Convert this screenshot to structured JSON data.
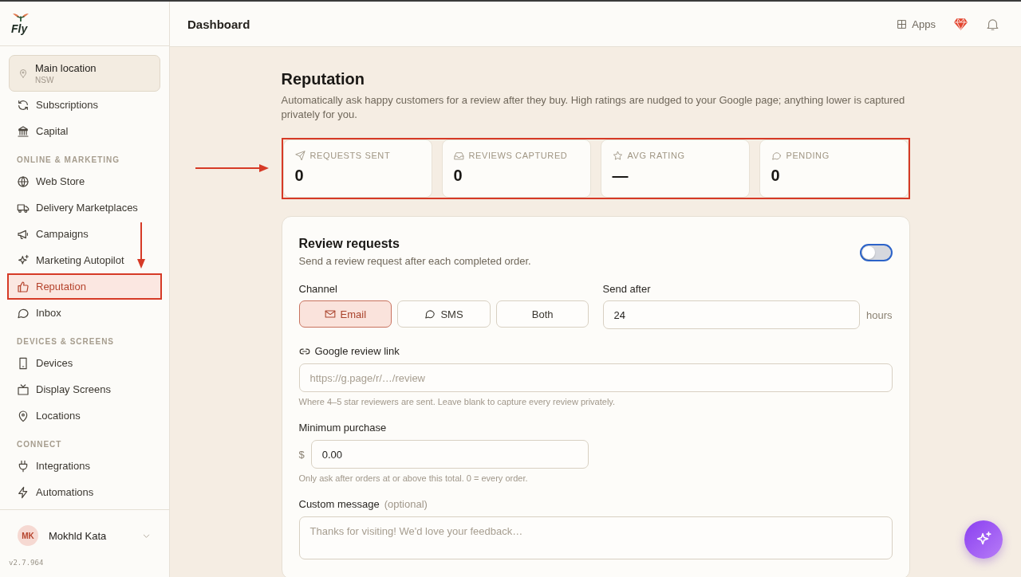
{
  "sidebar": {
    "logo_text": "Fly",
    "location": {
      "name": "Main location",
      "region": "NSW"
    },
    "nav": [
      {
        "items": [
          {
            "label": "Subscriptions",
            "selected": false
          },
          {
            "label": "Capital",
            "selected": false
          }
        ]
      },
      {
        "heading": "ONLINE & MARKETING",
        "items": [
          {
            "label": "Web Store",
            "selected": false
          },
          {
            "label": "Delivery Marketplaces",
            "selected": false
          },
          {
            "label": "Campaigns",
            "selected": false
          },
          {
            "label": "Marketing Autopilot",
            "selected": false
          },
          {
            "label": "Reputation",
            "selected": true
          },
          {
            "label": "Inbox",
            "selected": false
          }
        ]
      },
      {
        "heading": "DEVICES & SCREENS",
        "items": [
          {
            "label": "Devices",
            "selected": false
          },
          {
            "label": "Display Screens",
            "selected": false
          },
          {
            "label": "Locations",
            "selected": false
          }
        ]
      },
      {
        "heading": "CONNECT",
        "items": [
          {
            "label": "Integrations",
            "selected": false
          },
          {
            "label": "Automations",
            "selected": false
          }
        ]
      }
    ],
    "user": {
      "initials": "MK",
      "name": "Mokhld Kata"
    },
    "version": "v2.7.964"
  },
  "header": {
    "title": "Dashboard",
    "apps_label": "Apps"
  },
  "page": {
    "title": "Reputation",
    "description": "Automatically ask happy customers for a review after they buy. High ratings are nudged to your Google page; anything lower is captured privately for you."
  },
  "stats": [
    {
      "label": "REQUESTS SENT",
      "value": "0"
    },
    {
      "label": "REVIEWS CAPTURED",
      "value": "0"
    },
    {
      "label": "AVG RATING",
      "value": "—"
    },
    {
      "label": "PENDING",
      "value": "0"
    }
  ],
  "review_requests": {
    "title": "Review requests",
    "subtitle": "Send a review request after each completed order.",
    "on": false,
    "channel": {
      "label": "Channel",
      "options": [
        {
          "label": "Email",
          "selected": true
        },
        {
          "label": "SMS",
          "selected": false
        },
        {
          "label": "Both",
          "selected": false
        }
      ]
    },
    "send_after": {
      "label": "Send after",
      "value": "24",
      "unit": "hours"
    },
    "google_link": {
      "label": "Google review link",
      "placeholder": "https://g.page/r/…/review",
      "help": "Where 4–5 star reviewers are sent. Leave blank to capture every review privately."
    },
    "minimum_purchase": {
      "label": "Minimum purchase",
      "currency": "$",
      "value": "0.00",
      "help": "Only ask after orders at or above this total. 0 = every order."
    },
    "custom_message": {
      "label": "Custom message",
      "hint": "(optional)",
      "placeholder": "Thanks for visiting! We'd love your feedback…"
    }
  }
}
